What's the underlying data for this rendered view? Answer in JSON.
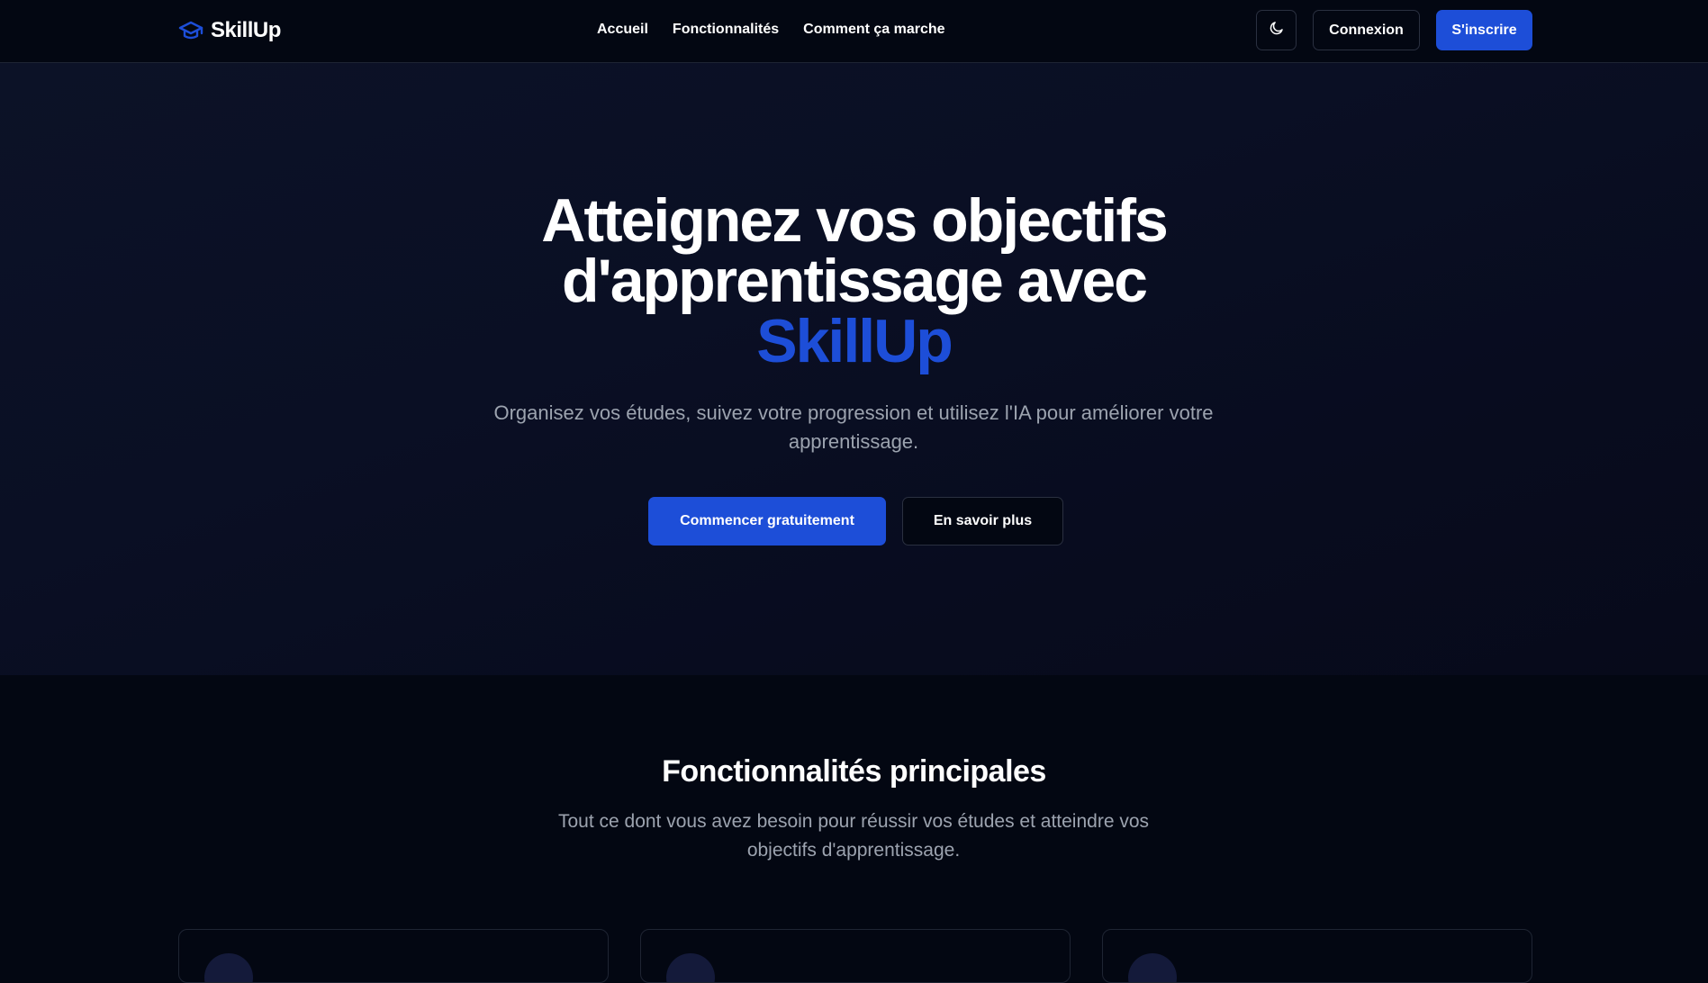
{
  "brand": {
    "name": "SkillUp"
  },
  "nav": {
    "links": [
      "Accueil",
      "Fonctionnalités",
      "Comment ça marche"
    ],
    "login_label": "Connexion",
    "signup_label": "S'inscrire"
  },
  "hero": {
    "title_line1": "Atteignez vos objectifs",
    "title_line2": "d'apprentissage avec",
    "title_brand": "SkillUp",
    "subtitle": "Organisez vos études, suivez votre progression et utilisez l'IA pour améliorer votre apprentissage.",
    "primary_cta": "Commencer gratuitement",
    "secondary_cta": "En savoir plus"
  },
  "features": {
    "title": "Fonctionnalités principales",
    "subtitle": "Tout ce dont vous avez besoin pour réussir vos études et atteindre vos objectifs d'apprentissage."
  },
  "icons": {
    "logo": "graduation-cap-icon",
    "theme": "moon-icon"
  },
  "colors": {
    "accent": "#1d4ed8",
    "background": "#030712",
    "muted_text": "#9ca3af"
  }
}
